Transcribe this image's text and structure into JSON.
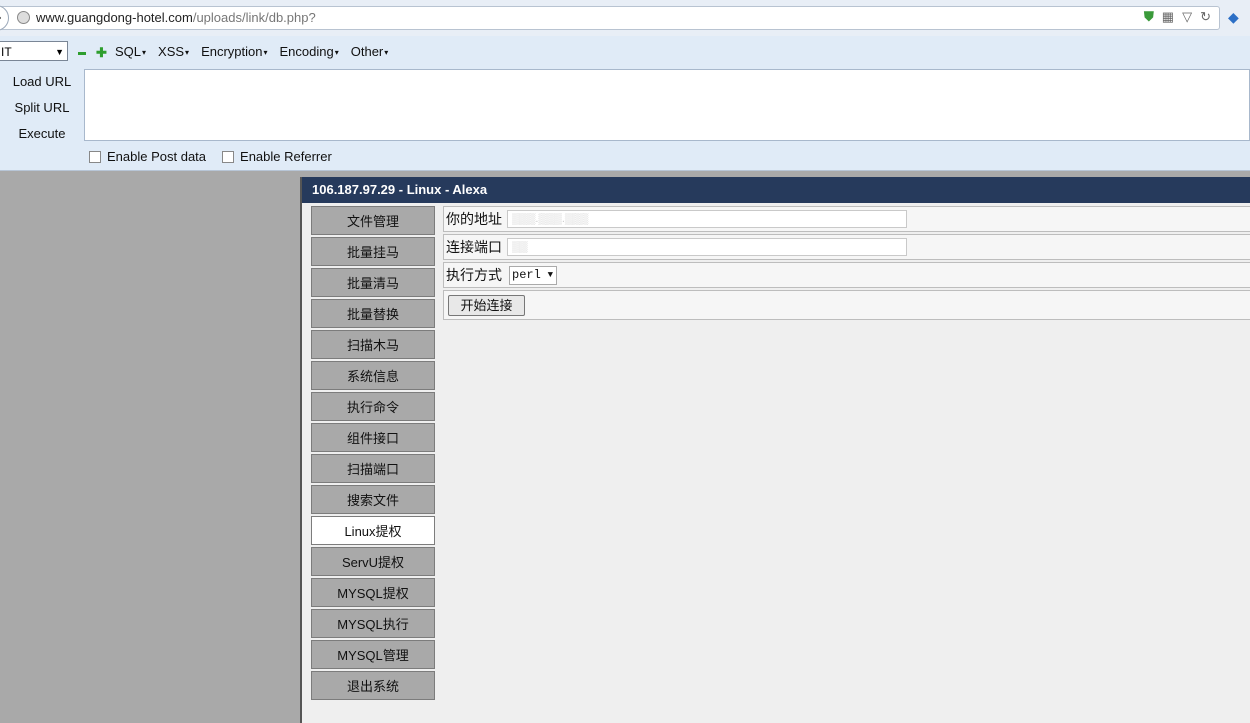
{
  "browser": {
    "url_domain": "www.guangdong-hotel.com",
    "url_path": "/uploads/link/db.php?",
    "icon_shield": "shield-icon",
    "icon_qr": "qr-icon",
    "icon_reload": "reload-icon"
  },
  "toolbar": {
    "select_value": "IT",
    "menus": [
      "SQL",
      "XSS",
      "Encryption",
      "Encoding",
      "Other"
    ],
    "commands": [
      "Load URL",
      "Split URL",
      "Execute"
    ],
    "checks": [
      "Enable Post data",
      "Enable Referrer"
    ]
  },
  "panel": {
    "title": "106.187.97.29 - Linux - Alexa",
    "nav": [
      "文件管理",
      "批量挂马",
      "批量清马",
      "批量替换",
      "扫描木马",
      "系统信息",
      "执行命令",
      "组件接口",
      "扫描端口",
      "搜索文件",
      "Linux提权",
      "ServU提权",
      "MYSQL提权",
      "MYSQL执行",
      "MYSQL管理",
      "退出系统"
    ],
    "active_nav": "Linux提权",
    "form": {
      "address_label": "你的地址",
      "port_label": "连接端口",
      "method_label": "执行方式",
      "method_value": "perl",
      "start_button": "开始连接"
    }
  },
  "colors": {
    "header_bg": "#263a5c",
    "page_bg": "#a9a9a9",
    "toolbar_bg": "#e0ebf7"
  }
}
